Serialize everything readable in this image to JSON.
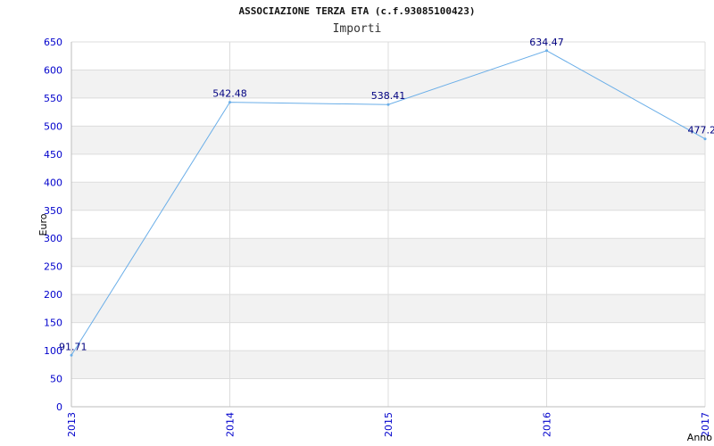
{
  "header": {
    "title": "ASSOCIAZIONE TERZA ETA (c.f.93085100423)",
    "subtitle": "Importi"
  },
  "chart_data": {
    "type": "line",
    "title": "ASSOCIAZIONE TERZA ETA (c.f.93085100423)",
    "subtitle": "Importi",
    "xlabel": "Anno",
    "ylabel": "Euro",
    "x": [
      "2013",
      "2014",
      "2015",
      "2016",
      "2017"
    ],
    "values": [
      91.71,
      542.48,
      538.41,
      634.47,
      477.2
    ],
    "labels": [
      "91.71",
      "542.48",
      "538.41",
      "634.47",
      "477.2"
    ],
    "ylim": [
      0,
      650
    ],
    "yticks": [
      0,
      50,
      100,
      150,
      200,
      250,
      300,
      350,
      400,
      450,
      500,
      550,
      600,
      650
    ],
    "grid": true,
    "colors": {
      "line": "#6aaee8",
      "tick_text": "#0000cc",
      "label_text": "#000080",
      "band": "#f2f2f2",
      "grid": "#dcdcdc"
    }
  }
}
